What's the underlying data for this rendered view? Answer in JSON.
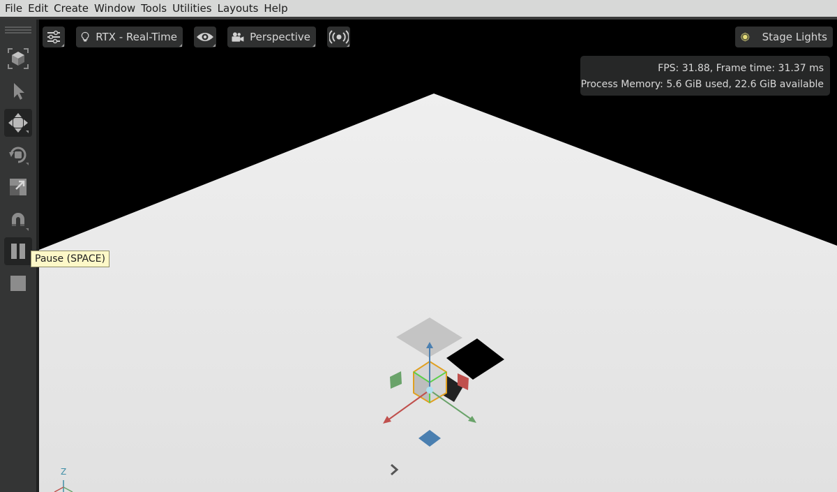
{
  "menu": [
    "File",
    "Edit",
    "Create",
    "Window",
    "Tools",
    "Utilities",
    "Layouts",
    "Help"
  ],
  "toolbar": {
    "tools": [
      {
        "name": "select-mode-cube-icon",
        "active": false
      },
      {
        "name": "select-arrow-icon",
        "active": false
      },
      {
        "name": "move-gizmo-icon",
        "active": true
      },
      {
        "name": "rotate-icon",
        "active": false
      },
      {
        "name": "scale-icon",
        "active": false
      },
      {
        "name": "snap-magnet-icon",
        "active": false
      },
      {
        "name": "pause-icon",
        "active": true
      },
      {
        "name": "stop-icon",
        "active": false
      }
    ],
    "tooltip": "Pause (SPACE)"
  },
  "viewport": {
    "render_mode": "RTX - Real-Time",
    "camera": "Perspective",
    "lights": "Stage Lights",
    "stats": {
      "fps_line": "FPS: 31.88, Frame time: 31.37 ms",
      "memory_line": "Process Memory: 5.6 GiB used, 22.6 GiB available"
    },
    "axis_label": "Z"
  },
  "colors": {
    "menubar_bg": "#d7d8d7",
    "toolbar_bg": "#343535",
    "viewport_bg": "#000000",
    "ground": "#e4e4e4",
    "gizmo_x": "#c0504d",
    "gizmo_y": "#6aa36a",
    "gizmo_z": "#4a7fb0",
    "selection": "#e0a020",
    "tooltip_bg": "#fdf8c8"
  }
}
